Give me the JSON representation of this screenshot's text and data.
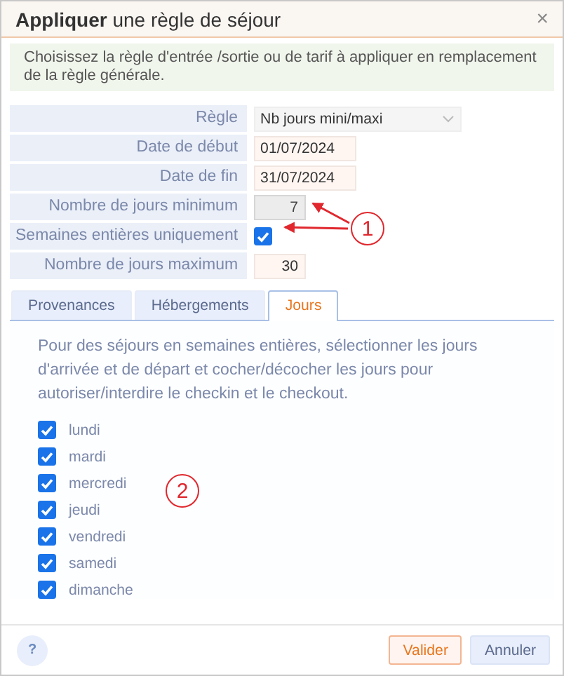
{
  "window": {
    "title": "**Appliquer** une règle de séjour",
    "close": "×"
  },
  "info": "Choisissez la règle d'entrée /sortie ou de tarif à appliquer en remplacement de la règle générale.",
  "form": [
    {
      "label": "Règle",
      "kind": "select",
      "value": "Nb jours mini/maxi"
    },
    {
      "label": "Date de début",
      "kind": "date",
      "value": "01/07/2024"
    },
    {
      "label": "Date de fin",
      "kind": "date",
      "value": "31/07/2024"
    },
    {
      "label": "Nombre de jours minimum",
      "kind": "number",
      "value": "7",
      "disabled": true
    },
    {
      "label": "Semaines entières uniquement",
      "kind": "checkbox",
      "checked": true
    },
    {
      "label": "Nombre de jours maximum",
      "kind": "number",
      "value": "30",
      "disabled": false
    }
  ],
  "tabs": [
    {
      "label": "Provenances",
      "selected": false
    },
    {
      "label": "Hébergements",
      "selected": false
    },
    {
      "label": "Jours",
      "selected": true
    }
  ],
  "tab_text": "Pour des séjours en semaines entières, sélectionner les jours d'arrivée et de départ et cocher/décocher les jours pour autoriser/interdire le checkin et le checkout.",
  "days": [
    {
      "label": "lundi",
      "checked": true
    },
    {
      "label": "mardi",
      "checked": true
    },
    {
      "label": "mercredi",
      "checked": true
    },
    {
      "label": "jeudi",
      "checked": true
    },
    {
      "label": "vendredi",
      "checked": true
    },
    {
      "label": "samedi",
      "checked": true
    },
    {
      "label": "dimanche",
      "checked": true
    }
  ],
  "annotations": [
    {
      "label": "1"
    },
    {
      "label": "2"
    }
  ],
  "footer": {
    "help": "?",
    "buttons": [
      {
        "label": "Valider",
        "kind": "primary"
      },
      {
        "label": "Annuler",
        "kind": "secondary"
      }
    ]
  }
}
